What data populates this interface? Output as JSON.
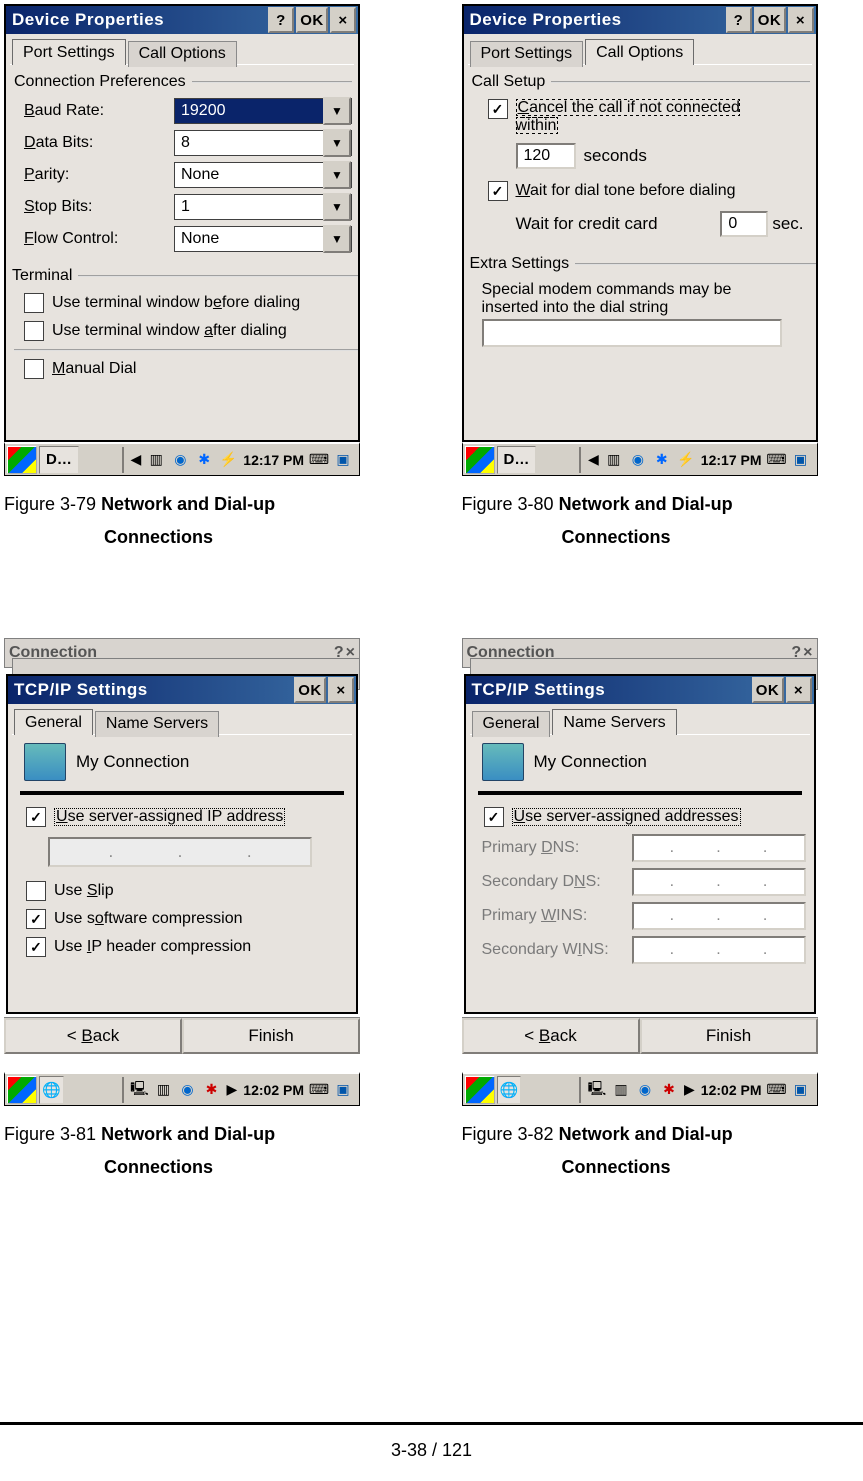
{
  "win1": {
    "title": "Device Properties",
    "btn_help": "?",
    "btn_ok": "OK",
    "btn_close": "×",
    "tab1": "Port Settings",
    "tab2": "Call Options",
    "group1": "Connection Preferences",
    "baud_lbl": "Baud Rate:",
    "baud_val": "19200",
    "data_lbl": "Data Bits:",
    "data_val": "8",
    "parity_lbl": "Parity:",
    "parity_val": "None",
    "stop_lbl": "Stop Bits:",
    "stop_val": "1",
    "flow_lbl": "Flow Control:",
    "flow_val": "None",
    "group2": "Terminal",
    "chk1": "Use terminal window before dialing",
    "chk2": "Use terminal window after dialing",
    "chk3": "Manual Dial",
    "task_app": "D…",
    "task_time": "12:17 PM"
  },
  "win2": {
    "title": "Device Properties",
    "btn_help": "?",
    "btn_ok": "OK",
    "btn_close": "×",
    "tab1": "Port Settings",
    "tab2": "Call Options",
    "group1": "Call Setup",
    "chk1a": "Cancel the call if not connected",
    "chk1b": "within",
    "seconds_val": "120",
    "seconds_lbl": "seconds",
    "chk2": "Wait for dial tone before dialing",
    "credit_lbl": "Wait for credit card",
    "credit_val": "0",
    "credit_sec": "sec.",
    "group2": "Extra Settings",
    "hint1": "Special modem commands may be",
    "hint2": "inserted into the dial string",
    "task_app": "D…",
    "task_time": "12:17 PM"
  },
  "win3": {
    "behind1": "Connection",
    "title": "TCP/IP Settings",
    "btn_ok": "OK",
    "btn_close": "×",
    "tab1": "General",
    "tab2": "Name Servers",
    "conn_name": "My Connection",
    "chk_ip": "Use server-assigned IP address",
    "chk_slip": "Use Slip",
    "chk_soft": "Use software compression",
    "chk_iphdr": "Use IP header compression",
    "back": "< Back",
    "finish": "Finish",
    "task_time": "12:02 PM"
  },
  "win4": {
    "behind1": "Connection",
    "title": "TCP/IP Settings",
    "btn_ok": "OK",
    "btn_close": "×",
    "tab1": "General",
    "tab2": "Name Servers",
    "conn_name": "My Connection",
    "chk_addr": "Use server-assigned addresses",
    "dns1": "Primary DNS:",
    "dns2": "Secondary DNS:",
    "wins1": "Primary WINS:",
    "wins2": "Secondary WINS:",
    "back": "< Back",
    "finish": "Finish",
    "task_time": "12:02 PM"
  },
  "captions": {
    "c1_pre": "Figure 3-79 ",
    "c1_bold": "Network and Dial-up",
    "c1_l2": "Connections",
    "c2_pre": "Figure 3-80 ",
    "c2_bold": "Network and Dial-up",
    "c2_l2": "Connections",
    "c3_pre": "Figure 3-81 ",
    "c3_bold": "Network and Dial-up",
    "c3_l2": "Connections",
    "c4_pre": "Figure 3-82 ",
    "c4_bold": "Network and Dial-up",
    "c4_l2": "Connections"
  },
  "pagenum": "3-38 / 121"
}
